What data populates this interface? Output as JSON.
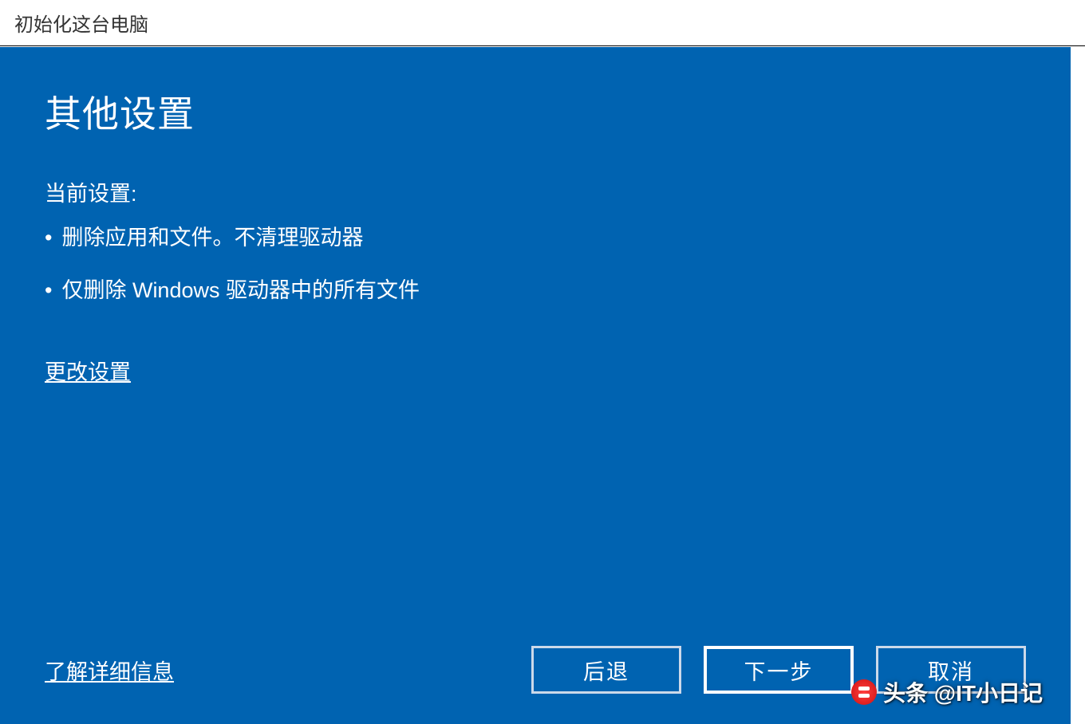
{
  "titlebar": {
    "text": "初始化这台电脑"
  },
  "main": {
    "title": "其他设置",
    "current_label": "当前设置:",
    "bullets": [
      "删除应用和文件。不清理驱动器",
      "仅删除 Windows 驱动器中的所有文件"
    ],
    "change_link": "更改设置"
  },
  "footer": {
    "learn_more": "了解详细信息",
    "back": "后退",
    "next": "下一步",
    "cancel": "取消"
  },
  "watermark": {
    "text": "头条 @IT小日记"
  }
}
